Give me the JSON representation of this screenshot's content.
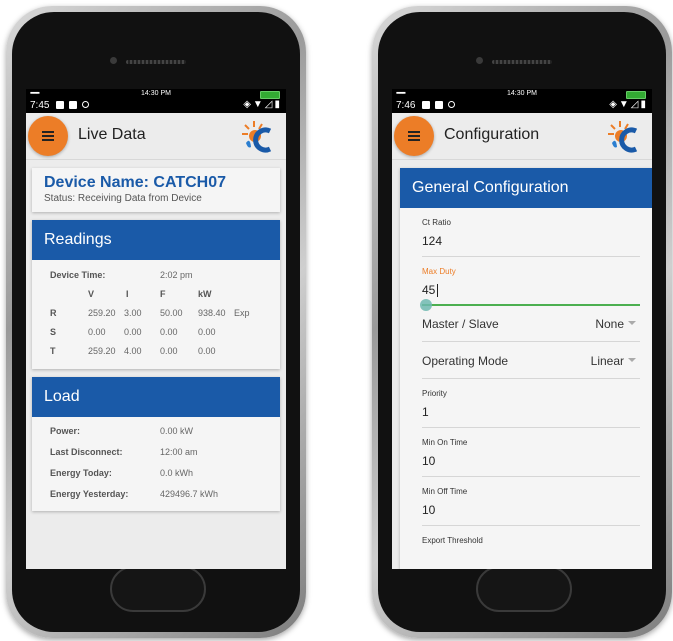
{
  "left": {
    "statusbar": {
      "time_top": "14:30 PM",
      "time": "7:45"
    },
    "appbar": {
      "title": "Live Data"
    },
    "device": {
      "name": "Device Name: CATCH07",
      "status": "Status: Receiving Data from Device"
    },
    "readings": {
      "title": "Readings",
      "device_time_label": "Device Time:",
      "device_time_value": "2:02 pm",
      "headers": [
        "V",
        "I",
        "F",
        "kW"
      ],
      "rows": [
        {
          "phase": "R",
          "v": "259.20",
          "i": "3.00",
          "f": "50.00",
          "kw": "938.40",
          "extra": "Exp"
        },
        {
          "phase": "S",
          "v": "0.00",
          "i": "0.00",
          "f": "0.00",
          "kw": "0.00",
          "extra": ""
        },
        {
          "phase": "T",
          "v": "259.20",
          "i": "4.00",
          "f": "0.00",
          "kw": "0.00",
          "extra": ""
        }
      ]
    },
    "load": {
      "title": "Load",
      "rows": [
        {
          "label": "Power:",
          "value": "0.00 kW"
        },
        {
          "label": "Last Disconnect:",
          "value": "12:00 am"
        },
        {
          "label": "Energy Today:",
          "value": "0.0 kWh"
        },
        {
          "label": "Energy Yesterday:",
          "value": "429496.7 kWh"
        }
      ]
    }
  },
  "right": {
    "statusbar": {
      "time_top": "14:30 PM",
      "time": "7:46"
    },
    "appbar": {
      "title": "Configuration"
    },
    "config": {
      "title": "General Configuration",
      "ct_ratio": {
        "label": "Ct Ratio",
        "value": "124"
      },
      "max_duty": {
        "label": "Max Duty",
        "value": "45"
      },
      "master_slave": {
        "label": "Master / Slave",
        "value": "None"
      },
      "operating_mode": {
        "label": "Operating Mode",
        "value": "Linear"
      },
      "priority": {
        "label": "Priority",
        "value": "1"
      },
      "min_on_time": {
        "label": "Min On Time",
        "value": "10"
      },
      "min_off_time": {
        "label": "Min Off Time",
        "value": "10"
      },
      "export_threshold": {
        "label": "Export Threshold"
      }
    }
  },
  "colors": {
    "accent_orange": "#ec7d27",
    "header_blue": "#1a5aa8",
    "focus_green": "#4caf50"
  }
}
